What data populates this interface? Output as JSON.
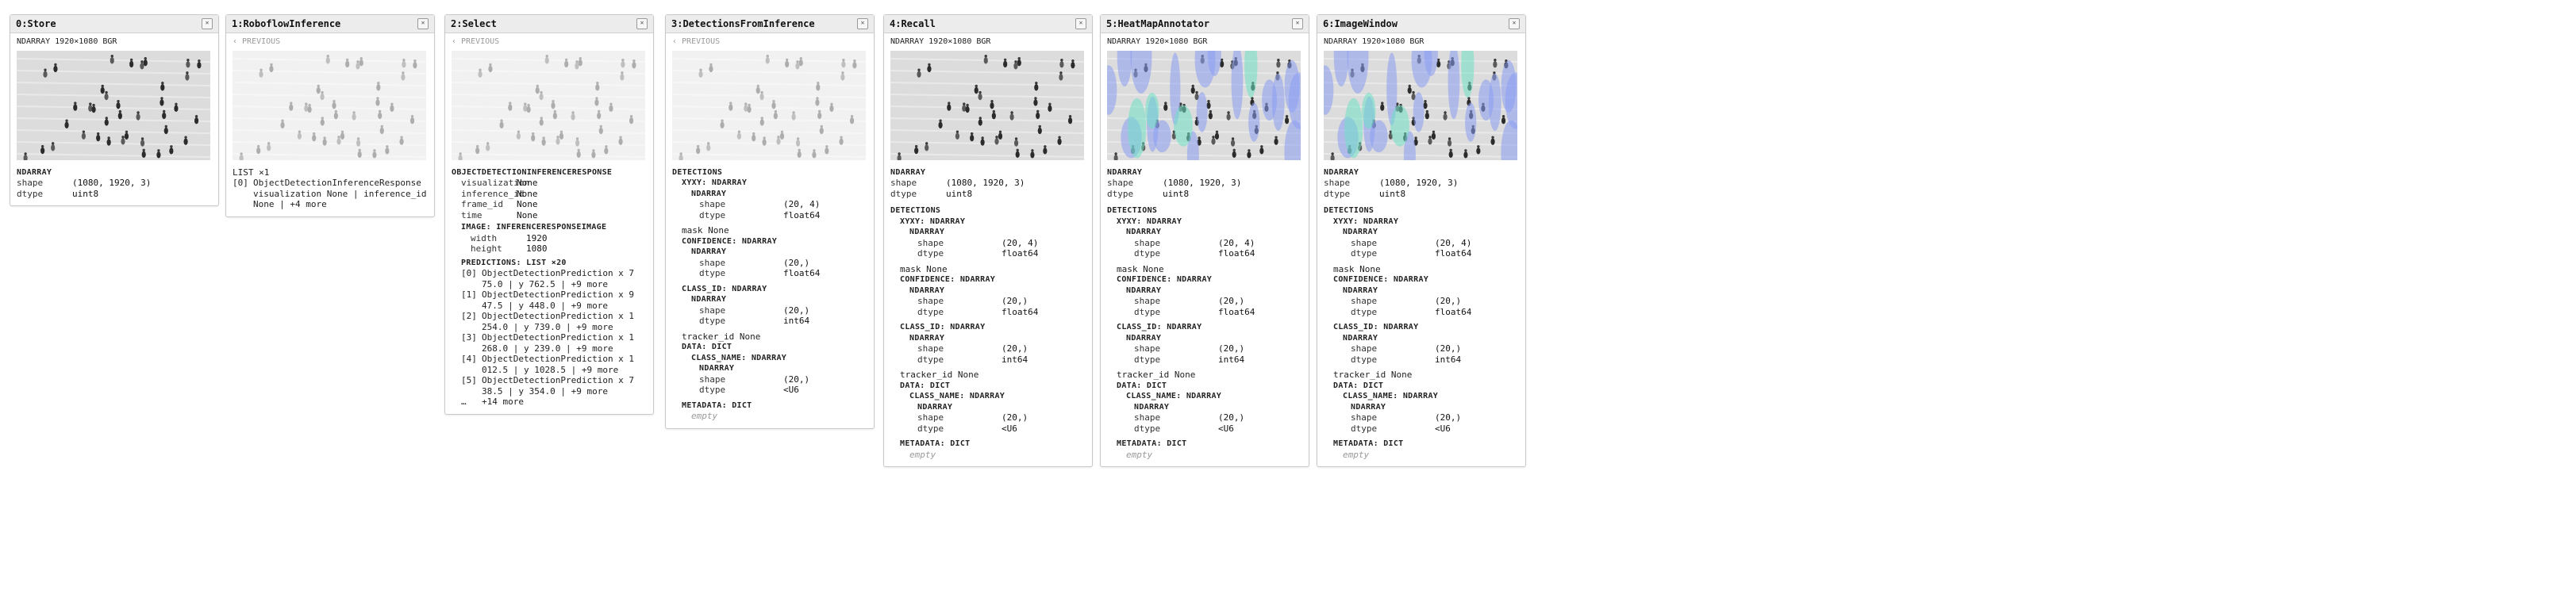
{
  "ndarray_meta": "NDARRAY 1920×1080 BGR",
  "previous_label": "‹ PREVIOUS",
  "labels": {
    "ndarray": "NDARRAY",
    "shape": "shape",
    "dtype": "dtype",
    "detections": "DETECTIONS",
    "xyxy": "XYXY: NDARRAY",
    "mask": "mask",
    "none": "None",
    "confidence": "CONFIDENCE: NDARRAY",
    "class_id": "CLASS_ID: NDARRAY",
    "tracker_id": "tracker_id",
    "data_dict": "DATA: DICT",
    "class_name": "CLASS_NAME: NDARRAY",
    "metadata": "METADATA: DICT",
    "empty": "empty"
  },
  "shapes": {
    "image": "(1080, 1920, 3)",
    "xyxy": "(20, 4)",
    "vec": "(20,)"
  },
  "dtypes": {
    "uint8": "uint8",
    "float64": "float64",
    "int64": "int64",
    "u6": "<U6"
  },
  "cards": {
    "store": {
      "title": "0:Store"
    },
    "roboflow": {
      "title": "1:RoboflowInference",
      "list_header": "LIST ×1",
      "item_index": "[0]",
      "item_text": "ObjectDetectionInferenceResponse visualization None | inference_id None | +4 more"
    },
    "select": {
      "title": "2:Select",
      "type": "OBJECTDETECTIONINFERENCERESPONSE",
      "fields": [
        {
          "k": "visualization",
          "v": "None"
        },
        {
          "k": "inference_id",
          "v": "None"
        },
        {
          "k": "frame_id",
          "v": "None"
        },
        {
          "k": "time",
          "v": "None"
        }
      ],
      "image_header": "IMAGE: INFERENCERESPONSEIMAGE",
      "image_fields": [
        {
          "k": "width",
          "v": "1920"
        },
        {
          "k": "height",
          "v": "1080"
        }
      ],
      "predictions_header": "PREDICTIONS: LIST ×20",
      "predictions": [
        {
          "i": "[0]",
          "t": "ObjectDetectionPrediction x 775.0 | y 762.5 | +9 more"
        },
        {
          "i": "[1]",
          "t": "ObjectDetectionPrediction x 947.5 | y 448.0 | +9 more"
        },
        {
          "i": "[2]",
          "t": "ObjectDetectionPrediction x 1254.0 | y 739.0 | +9 more"
        },
        {
          "i": "[3]",
          "t": "ObjectDetectionPrediction x 1268.0 | y 239.0 | +9 more"
        },
        {
          "i": "[4]",
          "t": "ObjectDetectionPrediction x 1012.5 | y 1028.5 | +9 more"
        },
        {
          "i": "[5]",
          "t": "ObjectDetectionPrediction x 738.5 | y 354.0 | +9 more"
        }
      ],
      "more_i": "…",
      "more_t": "+14 more"
    },
    "detections": {
      "title": "3:DetectionsFromInference"
    },
    "recall": {
      "title": "4:Recall"
    },
    "heatmap": {
      "title": "5:HeatMapAnnotator"
    },
    "imagewindow": {
      "title": "6:ImageWindow"
    }
  }
}
